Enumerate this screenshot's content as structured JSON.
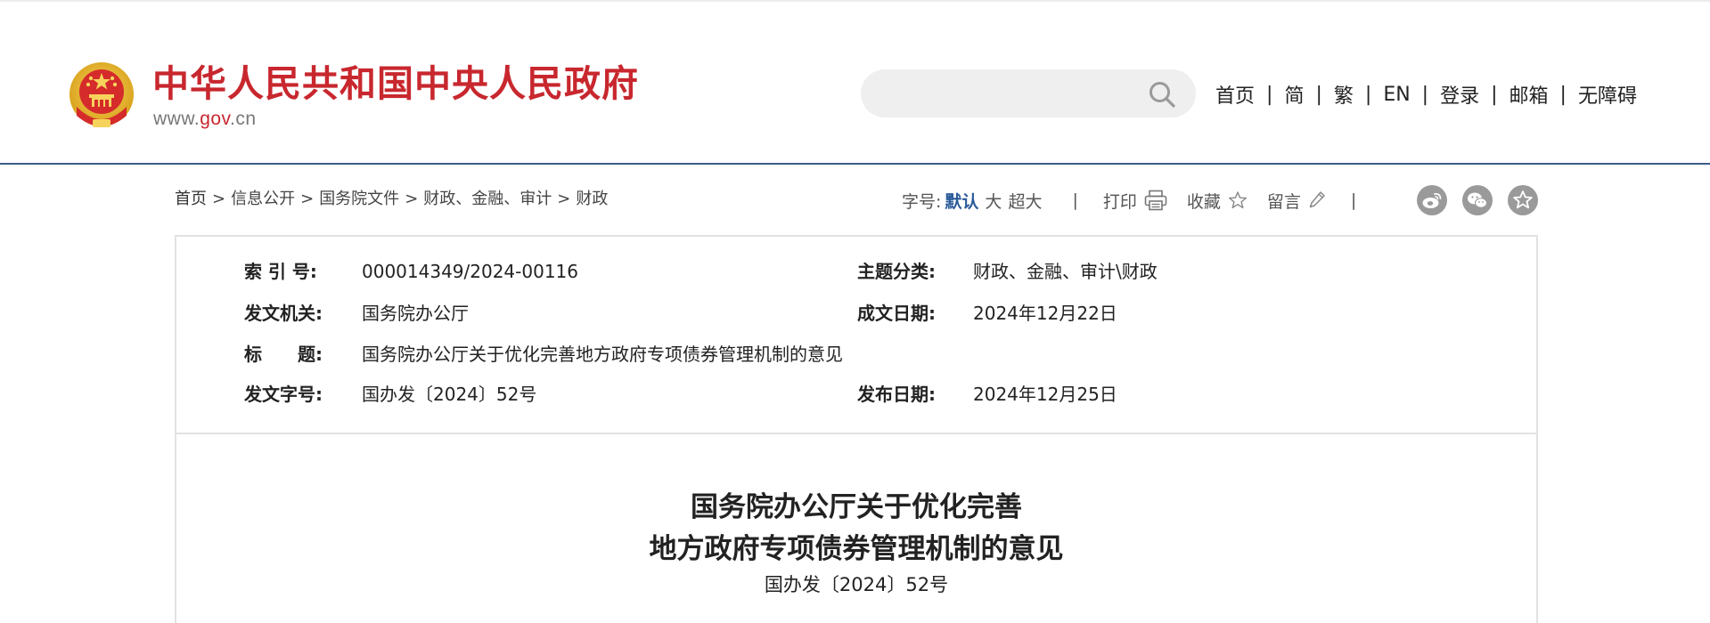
{
  "header": {
    "site_title": "中华人民共和国中央人民政府",
    "site_url_prefix": "www.",
    "site_url_accent": "gov",
    "site_url_suffix": ".cn",
    "search_placeholder": "",
    "nav": [
      "首页",
      "简",
      "繁",
      "EN",
      "登录",
      "邮箱",
      "无障碍"
    ],
    "nav_separator": "|"
  },
  "breadcrumb": {
    "items": [
      "首页",
      "信息公开",
      "国务院文件",
      "财政、金融、审计",
      "财政"
    ],
    "separator": ">"
  },
  "toolbar": {
    "font_size_label": "字号:",
    "font_default": "默认",
    "font_large": "大",
    "font_xlarge": "超大",
    "separator": "|",
    "print_label": "打印",
    "favorite_label": "收藏",
    "comment_label": "留言"
  },
  "share": [
    "weibo-icon",
    "wechat-icon",
    "favorite-star-icon"
  ],
  "info": {
    "index_no_label": "索 引 号:",
    "index_no": "000014349/2024-00116",
    "category_label": "主题分类:",
    "category": "财政、金融、审计\\财政",
    "issuer_label": "发文机关:",
    "issuer": "国务院办公厅",
    "written_date_label": "成文日期:",
    "written_date": "2024年12月22日",
    "title_label": "标　　题:",
    "title": "国务院办公厅关于优化完善地方政府专项债券管理机制的意见",
    "doc_no_label": "发文字号:",
    "doc_no": "国办发〔2024〕52号",
    "publish_date_label": "发布日期:",
    "publish_date": "2024年12月25日"
  },
  "document": {
    "title_line1": "国务院办公厅关于优化完善",
    "title_line2": "地方政府专项债券管理机制的意见",
    "doc_number": "国办发〔2024〕52号"
  },
  "colors": {
    "brand_red": "#c8272e",
    "header_rule": "#3a5e88",
    "link_blue": "#2a5a9a",
    "share_grey": "#9a9a9a"
  }
}
